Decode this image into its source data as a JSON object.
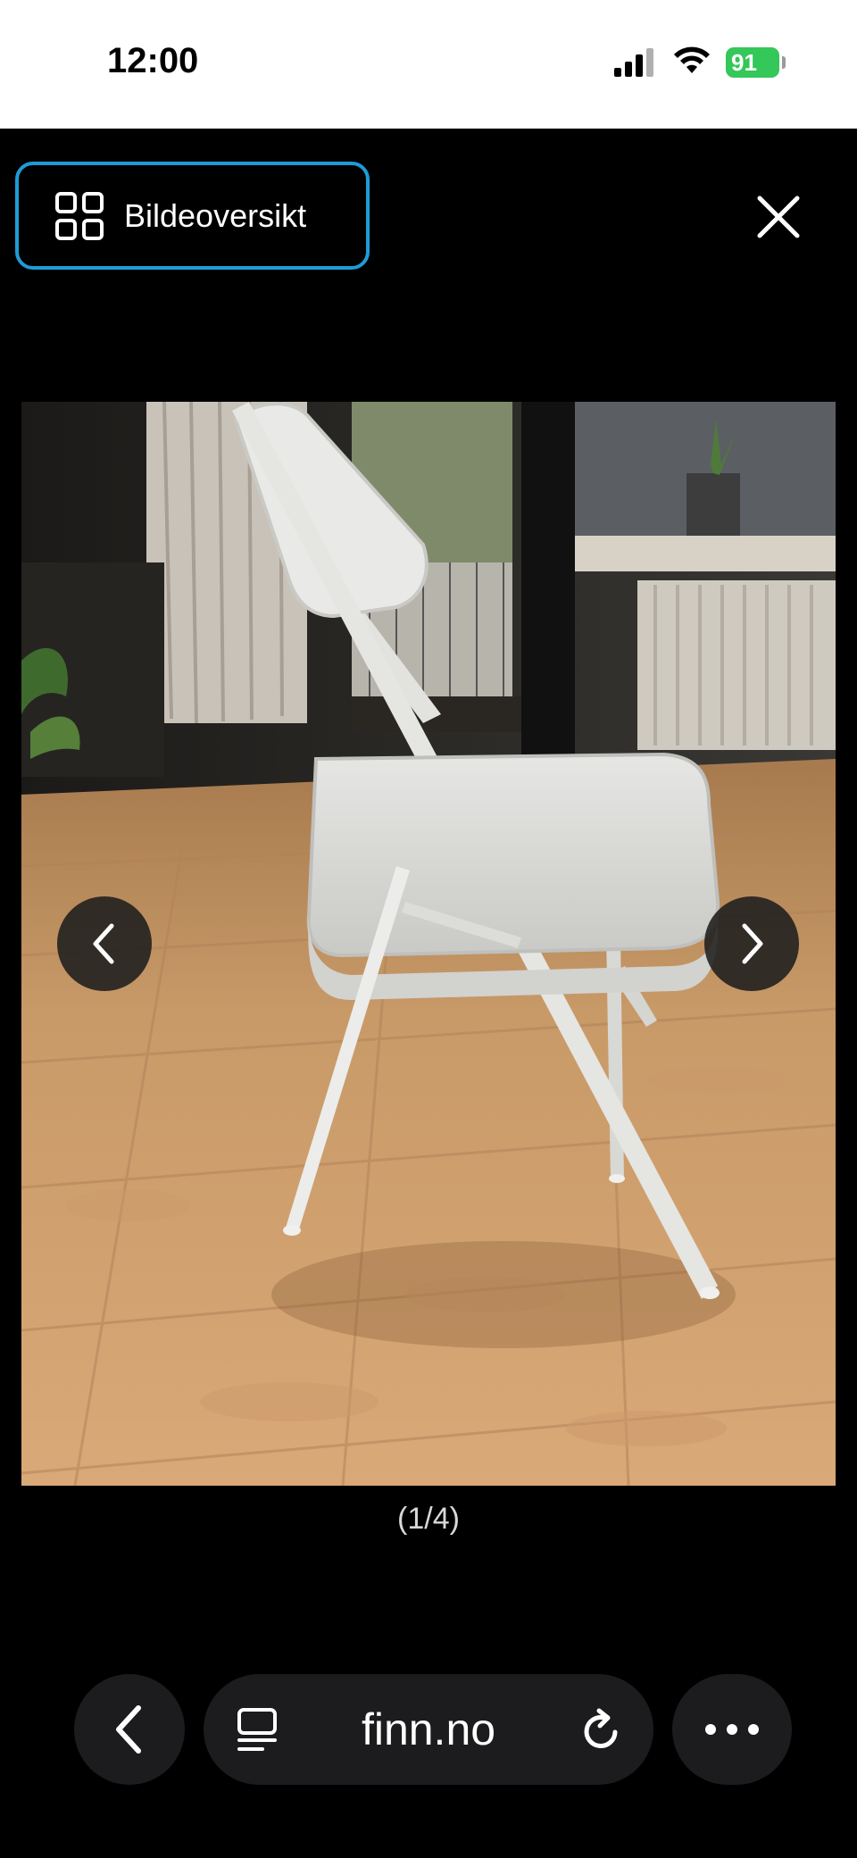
{
  "status_bar": {
    "time": "12:00",
    "battery": "91",
    "battery_color": "#34c759"
  },
  "viewer": {
    "overview_label": "Bildeoversikt",
    "overview_icon": "grid-icon",
    "close_icon": "close-icon",
    "accent": "#1e9bd7",
    "counter": "(1/4)",
    "prev_icon": "chevron-left-icon",
    "next_icon": "chevron-right-icon"
  },
  "browser": {
    "url": "finn.no",
    "back_icon": "chevron-left-icon",
    "reader_icon": "reader-icon",
    "reload_icon": "reload-icon",
    "more_icon": "more-icon"
  }
}
